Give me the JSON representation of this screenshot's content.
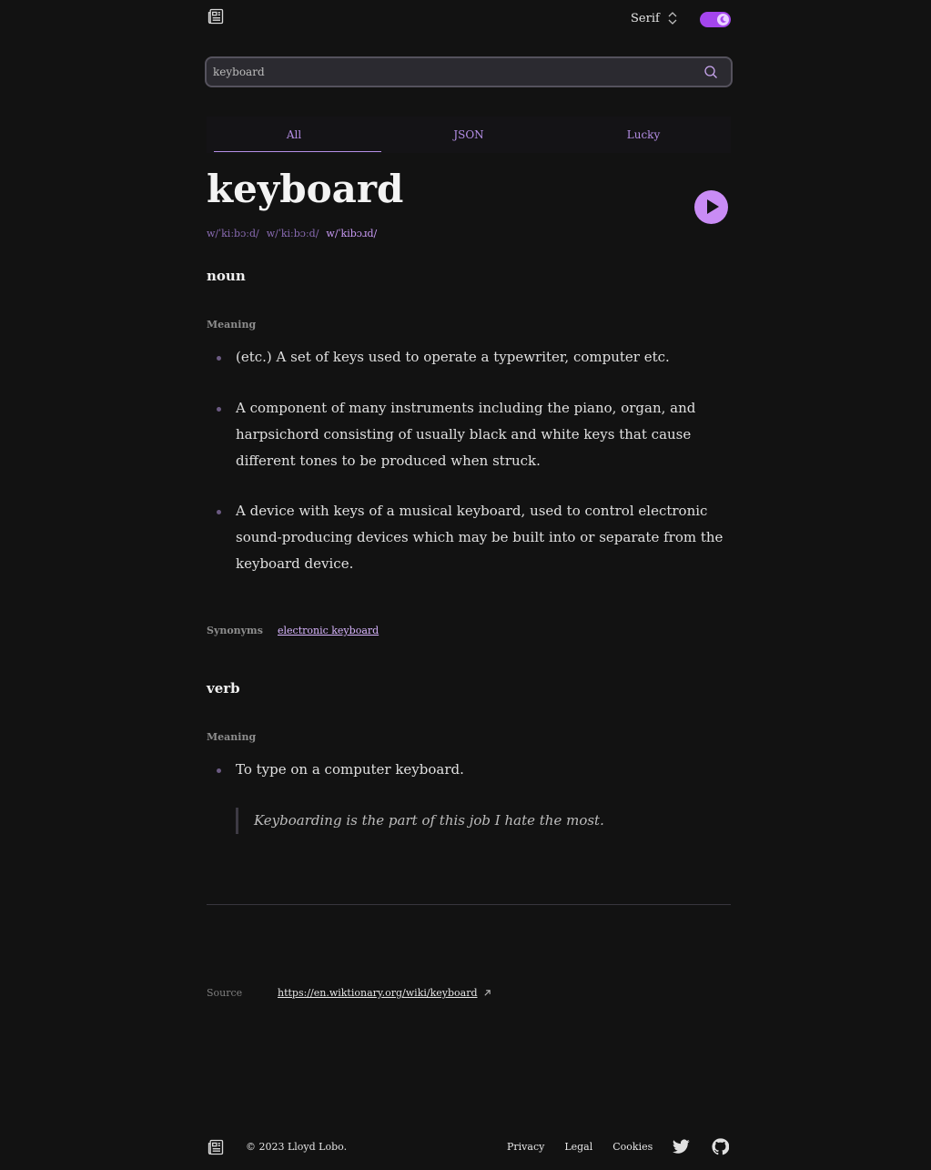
{
  "header": {
    "font_select": "Serif",
    "theme": "dark"
  },
  "search": {
    "value": "keyboard",
    "placeholder": "Search"
  },
  "tabs": [
    {
      "label": "All",
      "active": true
    },
    {
      "label": "JSON",
      "active": false
    },
    {
      "label": "Lucky",
      "active": false
    }
  ],
  "entry": {
    "word": "keyboard",
    "phonetics": [
      "w/ˈkiːbɔːd/",
      "w/ˈkiːbɔːd/",
      "w/ˈkibɔɹd/"
    ],
    "noun": {
      "pos": "noun",
      "meaning_label": "Meaning",
      "definitions": [
        "(etc.) A set of keys used to operate a typewriter, computer etc.",
        "A component of many instruments including the piano, organ, and harpsichord consisting of usually black and white keys that cause different tones to be produced when struck.",
        "A device with keys of a musical keyboard, used to control electronic sound-producing devices which may be built into or separate from the keyboard device."
      ],
      "synonyms_label": "Synonyms",
      "synonym": "electronic keyboard"
    },
    "verb": {
      "pos": "verb",
      "meaning_label": "Meaning",
      "definition": "To type on a computer keyboard.",
      "example": "Keyboarding is the part of this job I hate the most."
    }
  },
  "source": {
    "label": "Source",
    "url": "https://en.wiktionary.org/wiki/keyboard"
  },
  "footer": {
    "copyright": "© 2023 Lloyd Lobo.",
    "links": [
      "Privacy",
      "Legal",
      "Cookies"
    ]
  },
  "colors": {
    "background": "#121212",
    "accent": "#a445ed"
  }
}
